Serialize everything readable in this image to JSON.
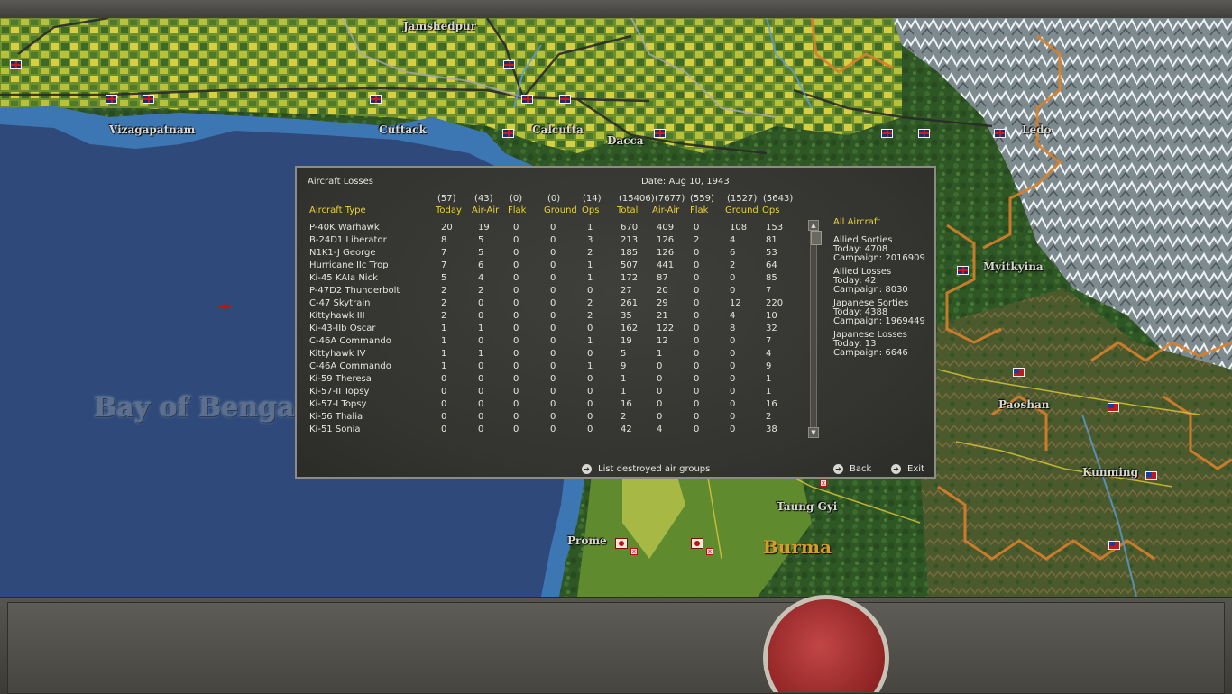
{
  "map": {
    "labels": [
      {
        "id": "jamshedpur",
        "text": "Jamshedpur"
      },
      {
        "id": "vizagapatnam",
        "text": "Vizagapatnam"
      },
      {
        "id": "cuttack",
        "text": "Cuttack"
      },
      {
        "id": "calcutta",
        "text": "Calcutta"
      },
      {
        "id": "dacca",
        "text": "Dacca"
      },
      {
        "id": "ledo",
        "text": "Ledo"
      },
      {
        "id": "myitkyina",
        "text": "Myitkyina"
      },
      {
        "id": "paoshan",
        "text": "Paoshan"
      },
      {
        "id": "kunming",
        "text": "Kunming"
      },
      {
        "id": "taung_gyi",
        "text": "Taung Gyi"
      },
      {
        "id": "prome",
        "text": "Prome"
      },
      {
        "id": "burma",
        "text": "Burma"
      },
      {
        "id": "bay_of_bengal",
        "text": "Bay of Bengal"
      }
    ]
  },
  "dialog": {
    "title": "Aircraft Losses",
    "date": "Date: Aug 10, 1943",
    "totals": [
      "(57)",
      "(43)",
      "(0)",
      "(0)",
      "(14)",
      "(15406)",
      "(7677)",
      "(559)",
      "(1527)",
      "(5643)"
    ],
    "headers": [
      "Aircraft Type",
      "Today",
      "Air-Air",
      "Flak",
      "Ground",
      "Ops",
      "Total",
      "Air-Air",
      "Flak",
      "Ground",
      "Ops"
    ],
    "rows": [
      [
        "P-40K Warhawk",
        "20",
        "19",
        "0",
        "0",
        "1",
        "670",
        "409",
        "0",
        "108",
        "153"
      ],
      [
        "B-24D1 Liberator",
        "8",
        "5",
        "0",
        "0",
        "3",
        "213",
        "126",
        "2",
        "4",
        "81"
      ],
      [
        "N1K1-J George",
        "7",
        "5",
        "0",
        "0",
        "2",
        "185",
        "126",
        "0",
        "6",
        "53"
      ],
      [
        "Hurricane IIc Trop",
        "7",
        "6",
        "0",
        "0",
        "1",
        "507",
        "441",
        "0",
        "2",
        "64"
      ],
      [
        "Ki-45 KAIa Nick",
        "5",
        "4",
        "0",
        "0",
        "1",
        "172",
        "87",
        "0",
        "0",
        "85"
      ],
      [
        "P-47D2 Thunderbolt",
        "2",
        "2",
        "0",
        "0",
        "0",
        "27",
        "20",
        "0",
        "0",
        "7"
      ],
      [
        "C-47 Skytrain",
        "2",
        "0",
        "0",
        "0",
        "2",
        "261",
        "29",
        "0",
        "12",
        "220"
      ],
      [
        "Kittyhawk III",
        "2",
        "0",
        "0",
        "0",
        "2",
        "35",
        "21",
        "0",
        "4",
        "10"
      ],
      [
        "Ki-43-IIb Oscar",
        "1",
        "1",
        "0",
        "0",
        "0",
        "162",
        "122",
        "0",
        "8",
        "32"
      ],
      [
        "C-46A Commando",
        "1",
        "0",
        "0",
        "0",
        "1",
        "19",
        "12",
        "0",
        "0",
        "7"
      ],
      [
        "Kittyhawk IV",
        "1",
        "1",
        "0",
        "0",
        "0",
        "5",
        "1",
        "0",
        "0",
        "4"
      ],
      [
        "C-46A Commando",
        "1",
        "0",
        "0",
        "0",
        "1",
        "9",
        "0",
        "0",
        "0",
        "9"
      ],
      [
        "Ki-59 Theresa",
        "0",
        "0",
        "0",
        "0",
        "0",
        "1",
        "0",
        "0",
        "0",
        "1"
      ],
      [
        "Ki-57-II Topsy",
        "0",
        "0",
        "0",
        "0",
        "0",
        "1",
        "0",
        "0",
        "0",
        "1"
      ],
      [
        "Ki-57-I Topsy",
        "0",
        "0",
        "0",
        "0",
        "0",
        "16",
        "0",
        "0",
        "0",
        "16"
      ],
      [
        "Ki-56 Thalia",
        "0",
        "0",
        "0",
        "0",
        "0",
        "2",
        "0",
        "0",
        "0",
        "2"
      ],
      [
        "Ki-51 Sonia",
        "0",
        "0",
        "0",
        "0",
        "0",
        "42",
        "4",
        "0",
        "0",
        "38"
      ]
    ],
    "summary": {
      "heading": "All Aircraft",
      "allied_sorties_label": "Allied Sorties",
      "allied_sorties_today": "Today:  4708",
      "allied_sorties_campaign": "Campaign: 2016909",
      "allied_losses_label": "Allied Losses",
      "allied_losses_today": "Today:   42",
      "allied_losses_campaign": "Campaign: 8030",
      "japanese_sorties_label": "Japanese Sorties",
      "japanese_sorties_today": "Today:   4388",
      "japanese_sorties_campaign": "Campaign: 1969449",
      "japanese_losses_label": "Japanese Losses",
      "japanese_losses_today": "Today:   13",
      "japanese_losses_campaign": "Campaign: 6646"
    },
    "buttons": {
      "list_destroyed": "List destroyed air groups",
      "back": "Back",
      "exit": "Exit"
    }
  },
  "colors": {
    "accent_yellow": "#e8d23a",
    "text": "#e6e6e0",
    "dialog_bg": "#383834",
    "ocean": "#2f4a7a"
  }
}
